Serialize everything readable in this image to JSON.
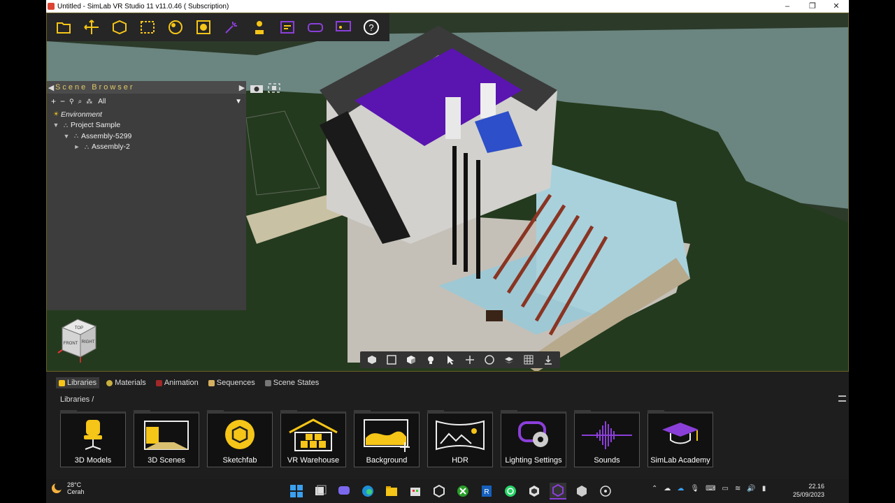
{
  "window": {
    "title": "Untitled - SimLab VR Studio 11 v11.0.46 ( Subscription)",
    "controls": [
      "–",
      "❐",
      "✕"
    ]
  },
  "toolbar": {
    "icons": [
      "open-icon",
      "transform-icon",
      "edit-icon",
      "select-region-icon",
      "materials-icon",
      "render-icon",
      "effects-icon",
      "vr-user-icon",
      "scene-list-icon",
      "vr-headset-icon",
      "presenter-icon",
      "help-icon"
    ]
  },
  "scene_browser": {
    "title": "Scene Browser",
    "filter": "All",
    "tree": [
      {
        "label": "Environment",
        "italic": true
      },
      {
        "label": "Project Sample",
        "arrow": "▼"
      },
      {
        "label": "Assembly-5299",
        "arrow": "▼"
      },
      {
        "label": "Assembly-2",
        "arrow": "►"
      }
    ]
  },
  "nav_cube": {
    "top": "TOP",
    "front": "FRONT",
    "right": "RIGHT"
  },
  "bottom_tabs": [
    "Libraries",
    "Materials",
    "Animation",
    "Sequences",
    "Scene States"
  ],
  "breadcrumb": {
    "root": "Libraries",
    "sep": "/"
  },
  "library_cards": [
    "3D Models",
    "3D Scenes",
    "Sketchfab",
    "VR Warehouse",
    "Background",
    "HDR",
    "Lighting Settings",
    "Sounds",
    "SimLab Academy"
  ],
  "colors": {
    "accent": "#f5c518",
    "purple": "#8b3fd9",
    "panel": "#3d3d3d"
  },
  "taskbar": {
    "temp": "28°C",
    "condition": "Cerah",
    "time": "22.16",
    "date": "25/09/2023"
  }
}
